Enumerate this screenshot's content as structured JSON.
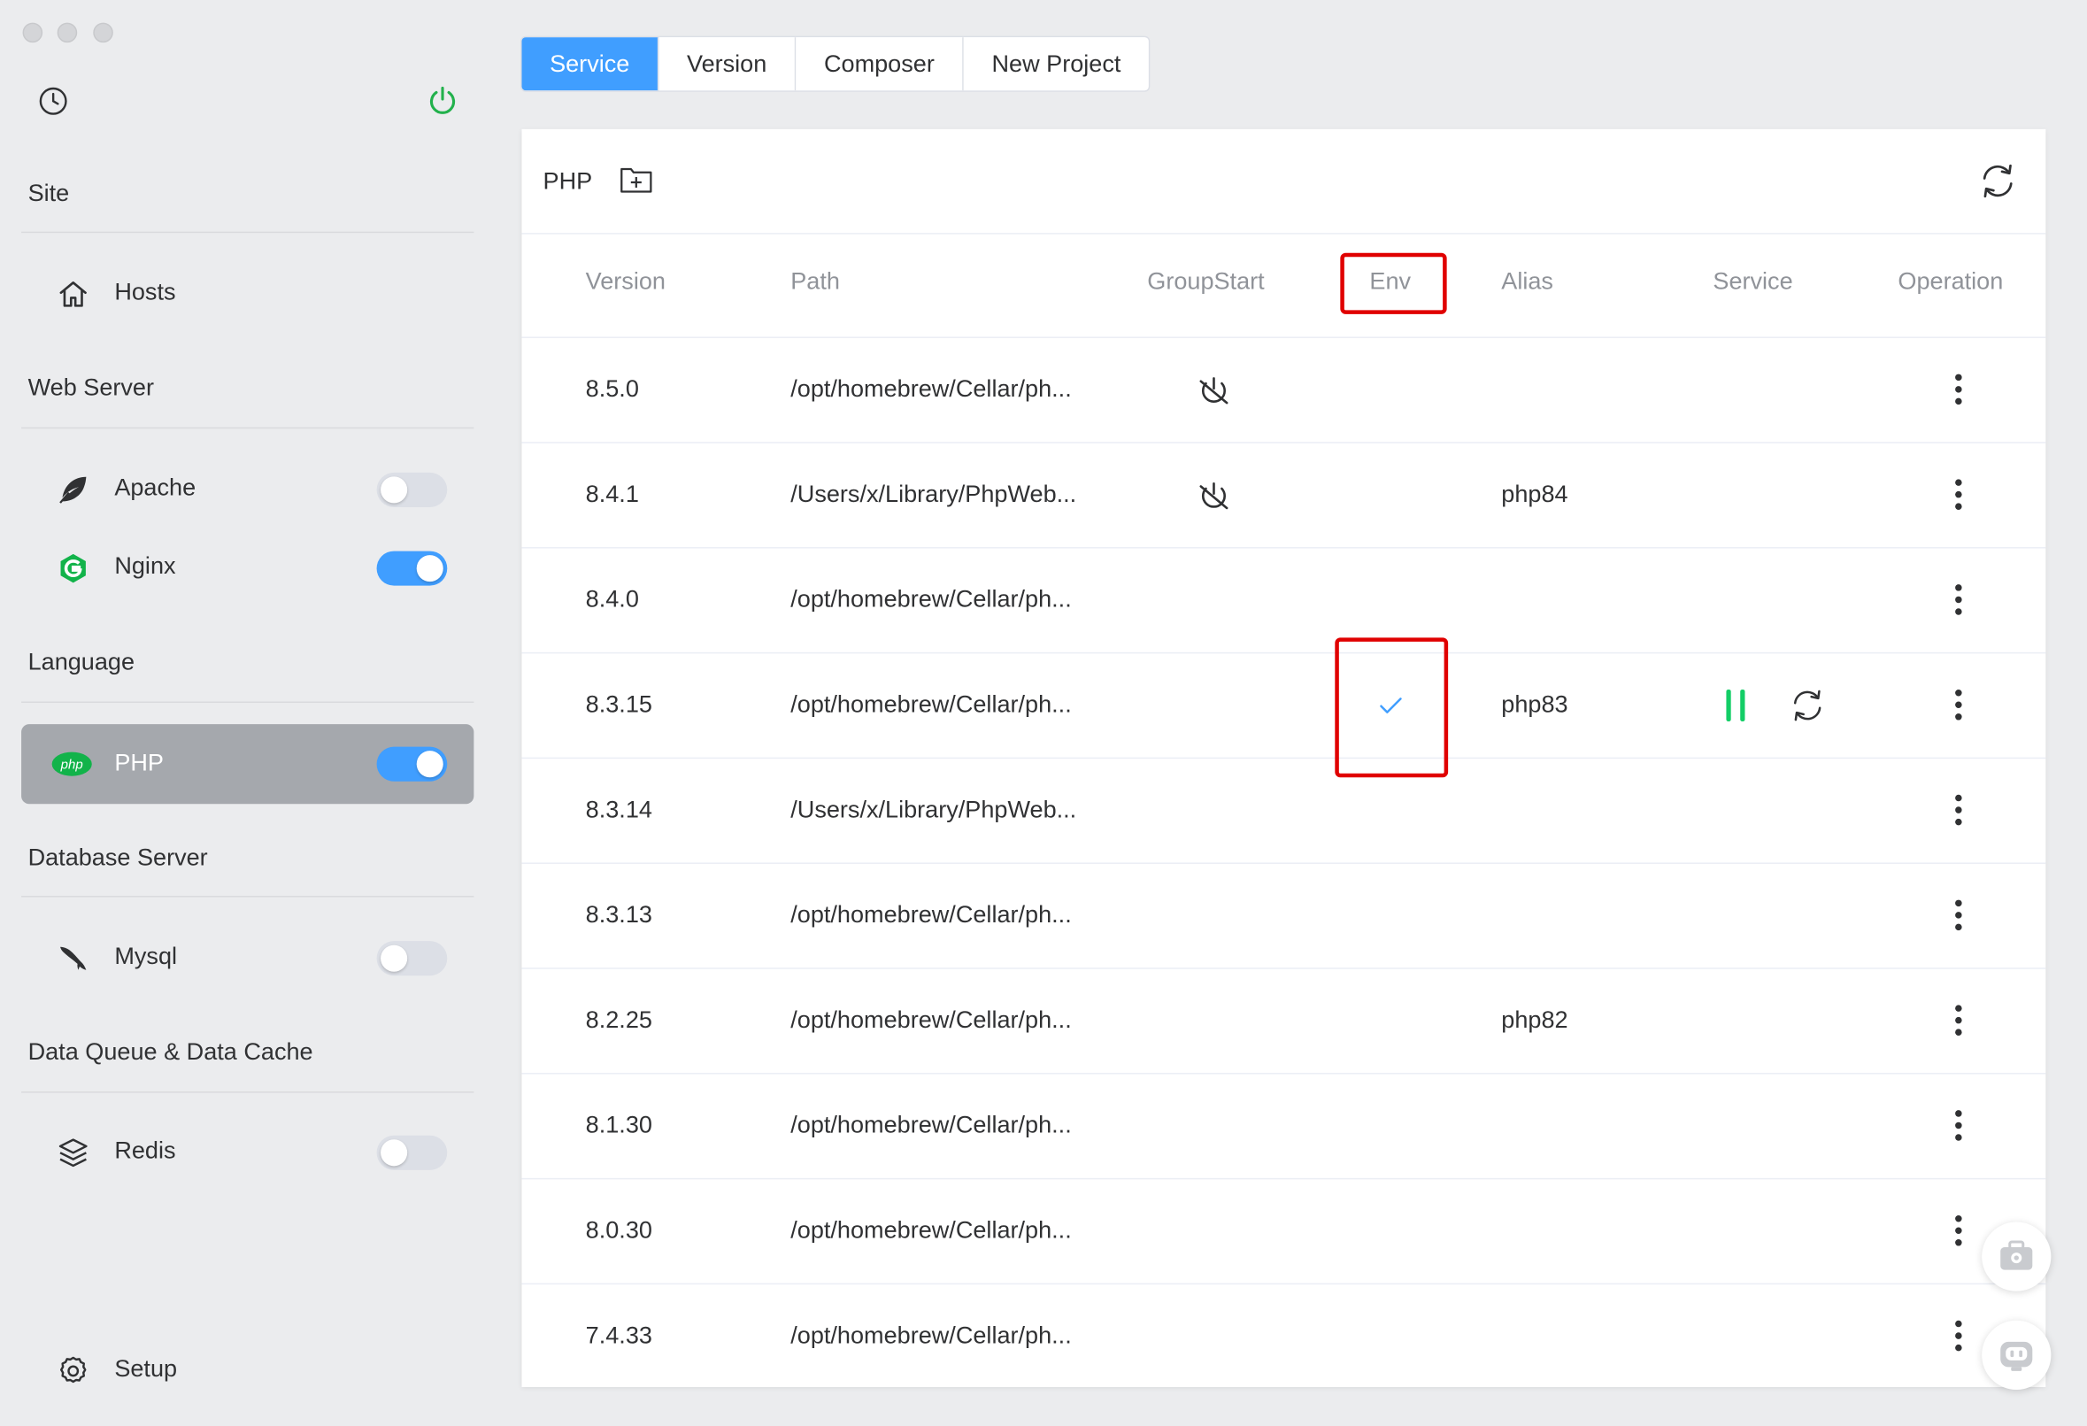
{
  "sidebar": {
    "sections": [
      {
        "label": "Site",
        "items": [
          {
            "label": "Hosts",
            "icon": "home-icon"
          }
        ]
      },
      {
        "label": "Web Server",
        "items": [
          {
            "label": "Apache",
            "icon": "feather-icon",
            "toggle": false
          },
          {
            "label": "Nginx",
            "icon": "nginx-icon",
            "toggle": true
          }
        ]
      },
      {
        "label": "Language",
        "items": [
          {
            "label": "PHP",
            "icon": "php-icon",
            "toggle": true,
            "active": true
          }
        ]
      },
      {
        "label": "Database Server",
        "items": [
          {
            "label": "Mysql",
            "icon": "dolphin-icon",
            "toggle": false
          }
        ]
      },
      {
        "label": "Data Queue & Data Cache",
        "items": [
          {
            "label": "Redis",
            "icon": "layers-icon",
            "toggle": false
          }
        ]
      }
    ],
    "setup_label": "Setup"
  },
  "tabs": [
    {
      "label": "Service",
      "active": true
    },
    {
      "label": "Version"
    },
    {
      "label": "Composer"
    },
    {
      "label": "New Project"
    }
  ],
  "panel": {
    "title": "PHP",
    "columns": [
      "Version",
      "Path",
      "GroupStart",
      "Env",
      "Alias",
      "Service",
      "Operation"
    ],
    "rows": [
      {
        "version": "8.5.0",
        "path": "/opt/homebrew/Cellar/ph...",
        "group_start": true,
        "env": false,
        "alias": "",
        "running": false
      },
      {
        "version": "8.4.1",
        "path": "/Users/x/Library/PhpWeb...",
        "group_start": true,
        "env": false,
        "alias": "php84",
        "running": false
      },
      {
        "version": "8.4.0",
        "path": "/opt/homebrew/Cellar/ph...",
        "group_start": false,
        "env": false,
        "alias": "",
        "running": false
      },
      {
        "version": "8.3.15",
        "path": "/opt/homebrew/Cellar/ph...",
        "group_start": false,
        "env": true,
        "alias": "php83",
        "running": true
      },
      {
        "version": "8.3.14",
        "path": "/Users/x/Library/PhpWeb...",
        "group_start": false,
        "env": false,
        "alias": "",
        "running": false
      },
      {
        "version": "8.3.13",
        "path": "/opt/homebrew/Cellar/ph...",
        "group_start": false,
        "env": false,
        "alias": "",
        "running": false
      },
      {
        "version": "8.2.25",
        "path": "/opt/homebrew/Cellar/ph...",
        "group_start": false,
        "env": false,
        "alias": "php82",
        "running": false
      },
      {
        "version": "8.1.30",
        "path": "/opt/homebrew/Cellar/ph...",
        "group_start": false,
        "env": false,
        "alias": "",
        "running": false
      },
      {
        "version": "8.0.30",
        "path": "/opt/homebrew/Cellar/ph...",
        "group_start": false,
        "env": false,
        "alias": "",
        "running": false
      },
      {
        "version": "7.4.33",
        "path": "/opt/homebrew/Cellar/ph...",
        "group_start": false,
        "env": false,
        "alias": "",
        "running": false
      }
    ]
  },
  "colors": {
    "accent": "#409eff",
    "running": "#13ce66",
    "power": "#22b14c",
    "highlight": "#e00000"
  }
}
